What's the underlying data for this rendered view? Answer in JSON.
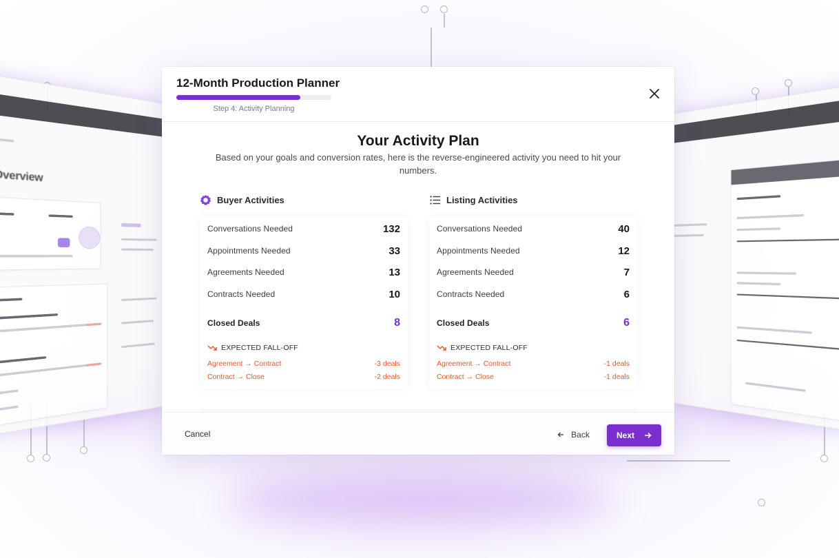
{
  "header": {
    "title": "12-Month Production Planner",
    "progress_percent": 80,
    "step_label": "Step 4: Activity Planning"
  },
  "plan": {
    "title": "Your Activity Plan",
    "description": "Based on your goals and conversion rates, here is the reverse-engineered activity you need to hit your numbers."
  },
  "buyer": {
    "title": "Buyer Activities",
    "icon": "buyer-badge-icon",
    "metrics": [
      {
        "label": "Conversations Needed",
        "value": "132"
      },
      {
        "label": "Appointments Needed",
        "value": "33"
      },
      {
        "label": "Agreements Needed",
        "value": "13"
      },
      {
        "label": "Contracts Needed",
        "value": "10"
      }
    ],
    "closed": {
      "label": "Closed Deals",
      "value": "8"
    },
    "falloff": {
      "heading": "EXPECTED FALL-OFF",
      "rows": [
        {
          "label": "Agreement → Contract",
          "value": "-3 deals"
        },
        {
          "label": "Contract → Close",
          "value": "-2 deals"
        }
      ]
    }
  },
  "listing": {
    "title": "Listing Activities",
    "icon": "list-icon",
    "metrics": [
      {
        "label": "Conversations Needed",
        "value": "40"
      },
      {
        "label": "Appointments Needed",
        "value": "12"
      },
      {
        "label": "Agreements Needed",
        "value": "7"
      },
      {
        "label": "Contracts Needed",
        "value": "6"
      }
    ],
    "closed": {
      "label": "Closed Deals",
      "value": "6"
    },
    "falloff": {
      "heading": "EXPECTED FALL-OFF",
      "rows": [
        {
          "label": "Agreement → Contract",
          "value": "-1 deals"
        },
        {
          "label": "Contract → Close",
          "value": "-1 deals"
        }
      ]
    }
  },
  "footer": {
    "cancel_label": "Cancel",
    "back_label": "Back",
    "next_label": "Next"
  },
  "colors": {
    "accent": "#7a2fcf",
    "falloff": "#e25a2e"
  },
  "background": {
    "left_panel_heading": "n Overview"
  }
}
